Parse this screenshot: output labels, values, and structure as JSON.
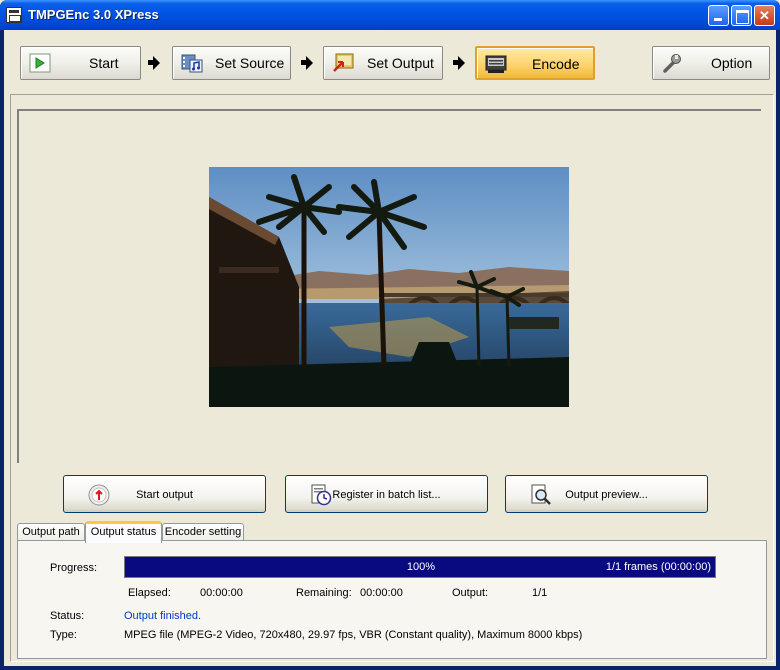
{
  "window": {
    "title": "TMPGEnc 3.0 XPress"
  },
  "toolbar": {
    "steps": [
      {
        "label": "Start"
      },
      {
        "label": "Set Source"
      },
      {
        "label": "Set Output"
      },
      {
        "label": "Encode"
      }
    ],
    "option_label": "Option",
    "active_step": "Encode"
  },
  "actions": {
    "start_output": "Start output",
    "register_batch": "Register in batch list...",
    "output_preview": "Output preview..."
  },
  "tabs": [
    {
      "label": "Output path"
    },
    {
      "label": "Output status"
    },
    {
      "label": "Encoder setting"
    }
  ],
  "active_tab": "Output status",
  "status": {
    "progress_label": "Progress:",
    "progress_percent": 100,
    "progress_text": "100%",
    "frames_text": "1/1  frames (00:00:00)",
    "elapsed_label": "Elapsed:",
    "elapsed_value": "00:00:00",
    "remaining_label": "Remaining:",
    "remaining_value": "00:00:00",
    "output_label": "Output:",
    "output_value": "1/1",
    "status_label": "Status:",
    "status_value": "Output finished.",
    "type_label": "Type:",
    "type_value": "MPEG file (MPEG-2 Video, 720x480, 29.97 fps, VBR (Constant quality), Maximum 8000 kbps)"
  },
  "colors": {
    "titlebar": "#0055e5",
    "progress_fill": "#0a0a80",
    "active_step": "#fcd26a",
    "status_text": "#0038c8"
  },
  "icons": {
    "start": "play-icon",
    "set_source": "film-music-icon",
    "set_output": "output-icon",
    "encode": "encoder-icon",
    "option": "wrench-icon"
  }
}
